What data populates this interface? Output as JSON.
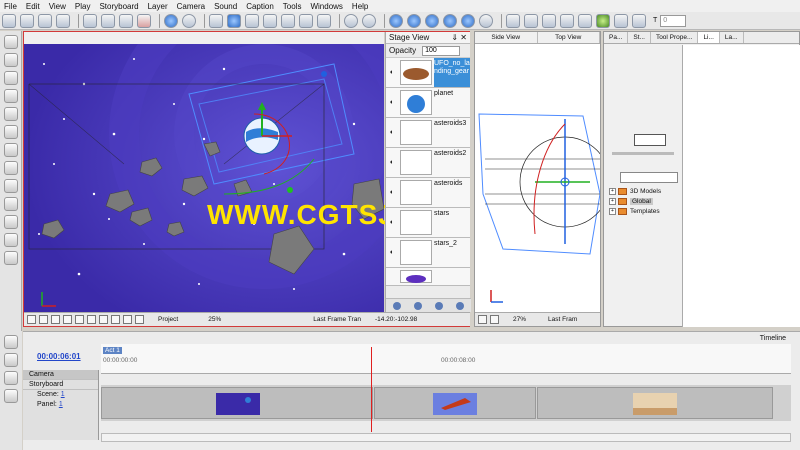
{
  "menu": [
    "File",
    "Edit",
    "View",
    "Play",
    "Storyboard",
    "Layer",
    "Camera",
    "Sound",
    "Caption",
    "Tools",
    "Windows",
    "Help"
  ],
  "toolbar": {
    "frame_label": "T",
    "frame_value": "0"
  },
  "watermark": "WWW.CGTSJ.COM",
  "stage_panel": {
    "title": "Stage View",
    "opacity_label": "Opacity",
    "opacity_value": "100",
    "layers": [
      {
        "name": "UFO_no_landing_gear",
        "selected": true
      },
      {
        "name": "planet"
      },
      {
        "name": "asteroids3"
      },
      {
        "name": "asteroids2"
      },
      {
        "name": "asteroids"
      },
      {
        "name": "stars"
      },
      {
        "name": "stars_2"
      },
      {
        "name": ""
      }
    ]
  },
  "stage_status": {
    "scope": "Project",
    "zoom": "25%",
    "frame_label": "Last Frame Tran",
    "coords": "-14.20:-102.98"
  },
  "side_view": {
    "tab_side": "Side View",
    "tab_top": "Top View",
    "zoom": "27%",
    "frame_label": "Last Fram"
  },
  "library": {
    "tabs": [
      "Pa...",
      "St...",
      "Tool Prope...",
      "Li...",
      "La..."
    ],
    "tree": [
      "3D Models",
      "Global",
      "Templates"
    ]
  },
  "timeline": {
    "title": "Timeline",
    "current_time": "00:00:06:01",
    "act": "Act 1",
    "tick_start": "00:00:00:00",
    "tick_mid": "00:00:08:00",
    "rows": [
      "Camera",
      "Storyboard"
    ],
    "scene_label": "Scene:",
    "scene_value": "1",
    "panel_label": "Panel:",
    "panel_value": "1"
  }
}
